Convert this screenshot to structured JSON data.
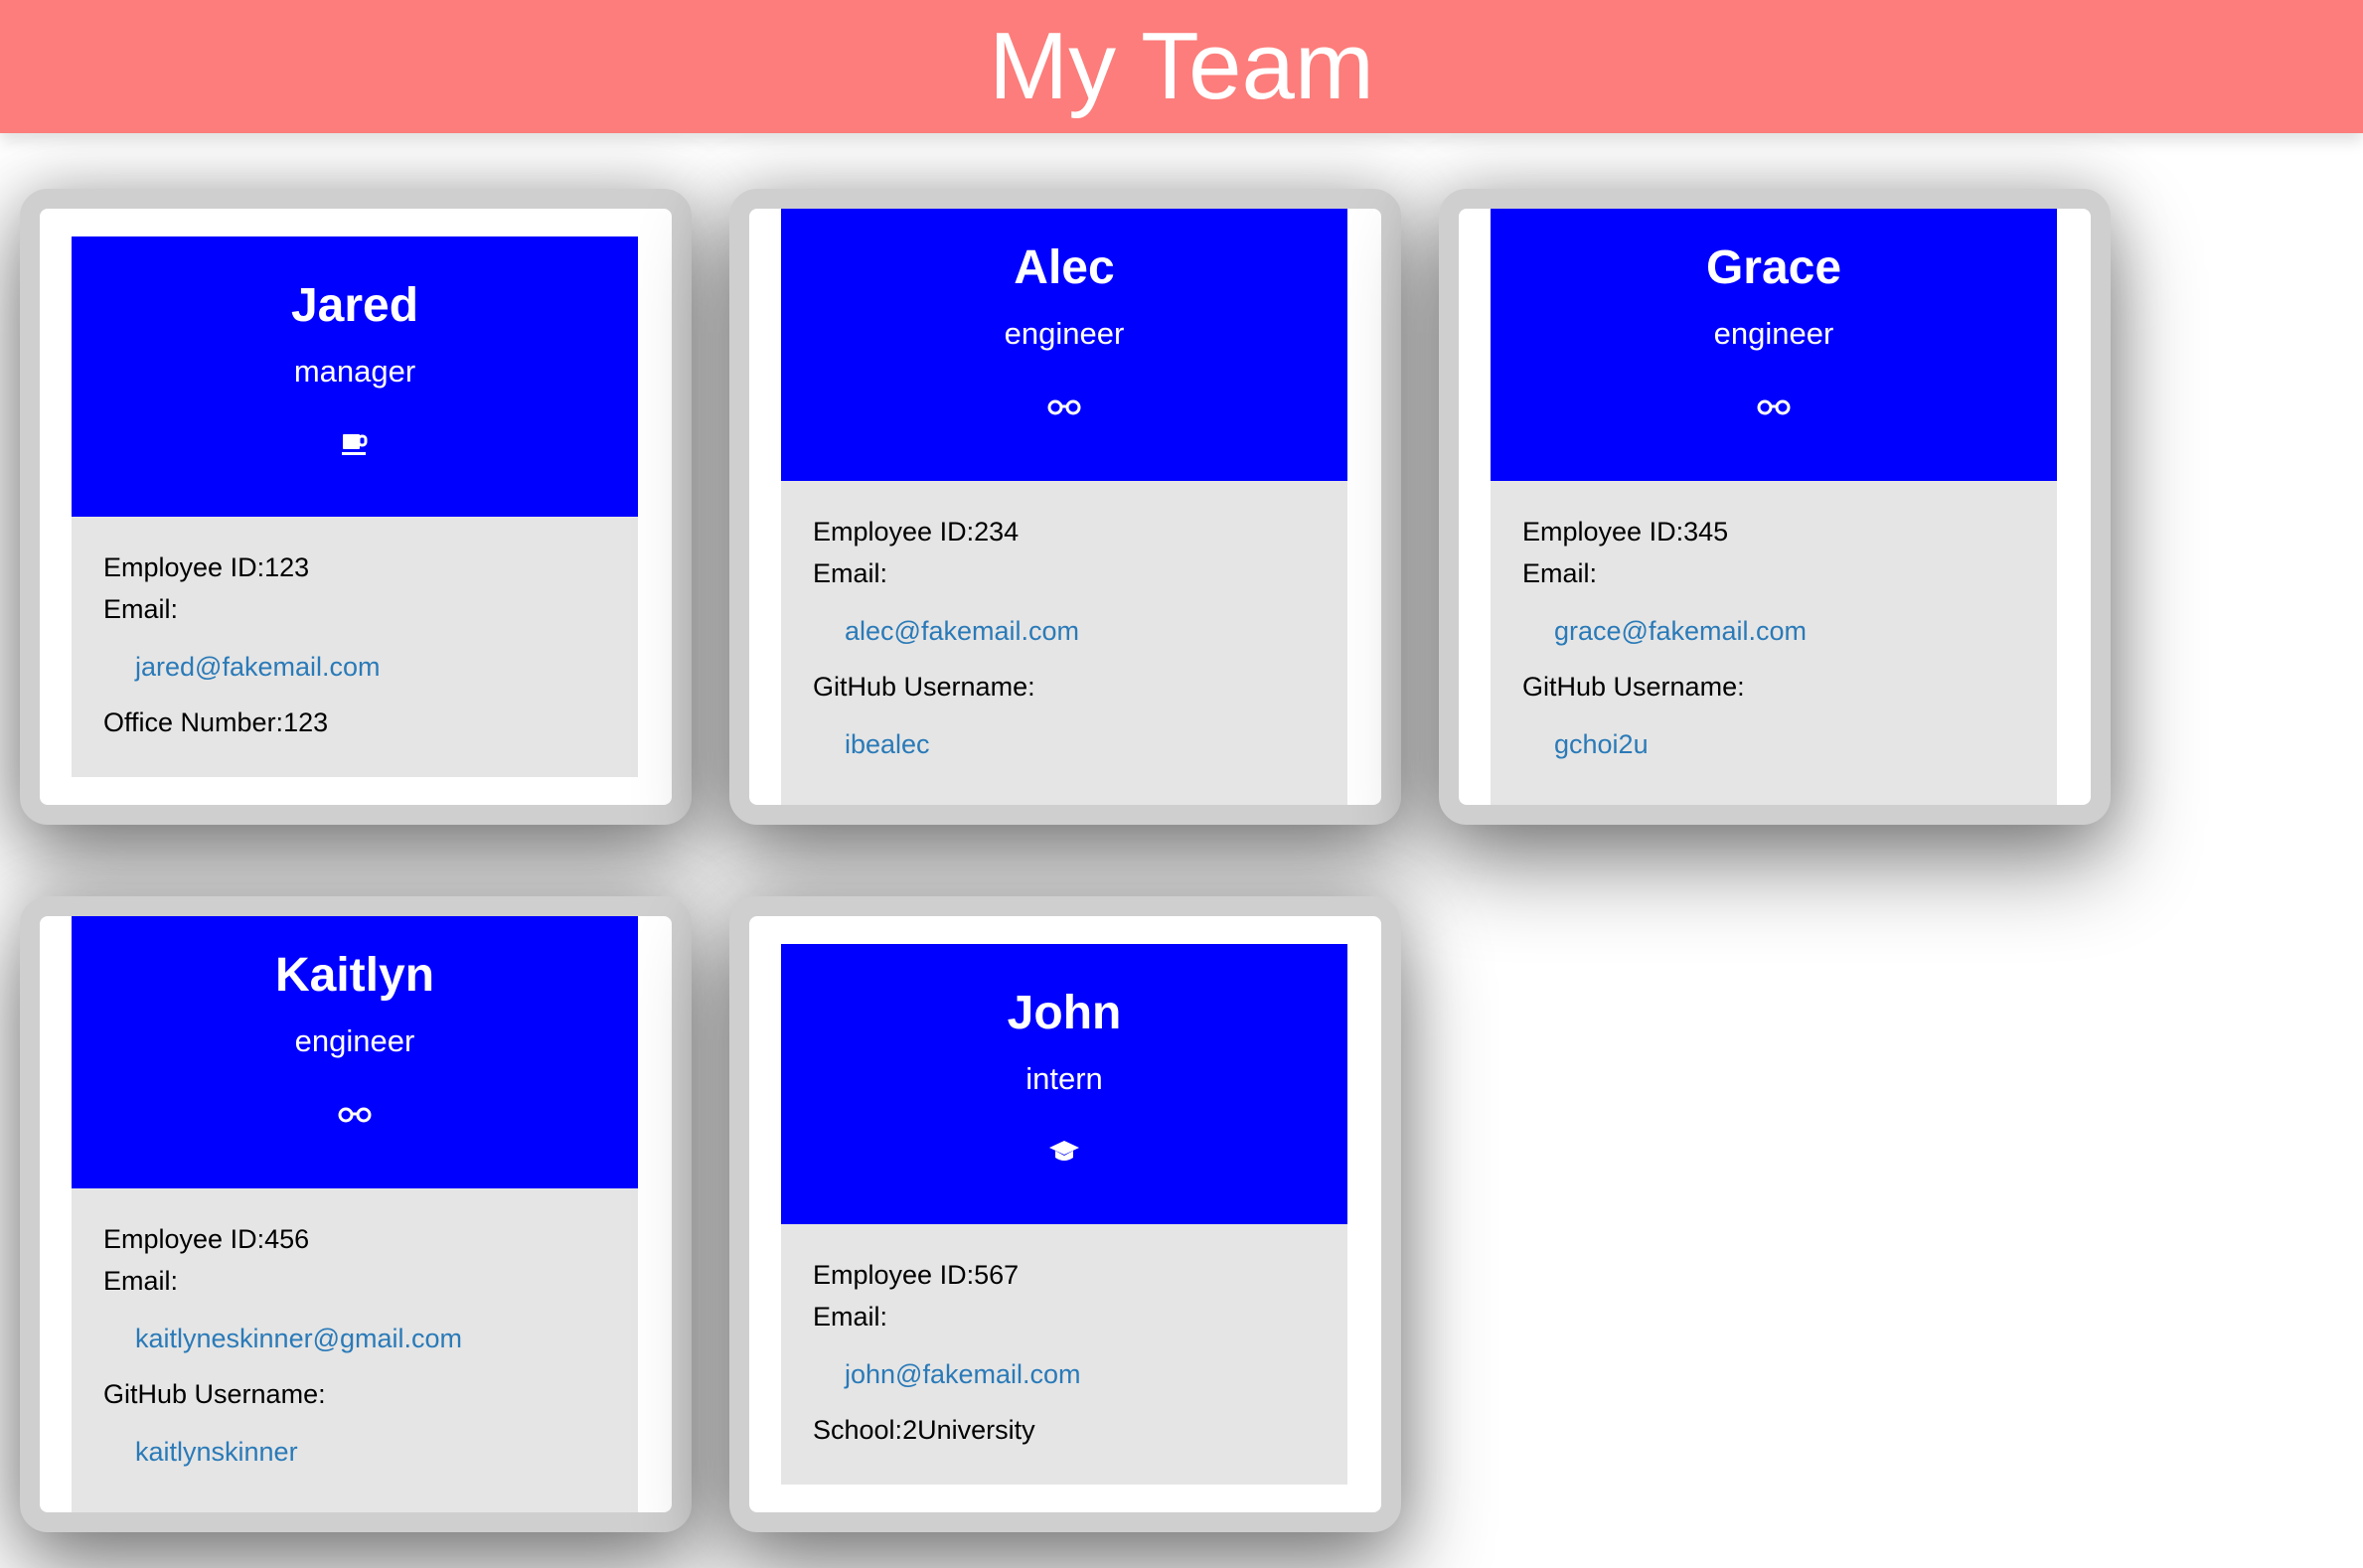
{
  "header": {
    "title": "My Team"
  },
  "labels": {
    "employee_id": "Employee ID:",
    "email": "Email:",
    "office": "Office Number:",
    "github": "GitHub Username:",
    "school": "School:"
  },
  "cards": [
    {
      "name": "Jared",
      "role": "manager",
      "icon": "coffee-icon",
      "id": "123",
      "email": "jared@fakemail.com",
      "office": "123"
    },
    {
      "name": "Alec",
      "role": "engineer",
      "icon": "glasses-icon",
      "id": "234",
      "email": "alec@fakemail.com",
      "github": "ibealec"
    },
    {
      "name": "Grace",
      "role": "engineer",
      "icon": "glasses-icon",
      "id": "345",
      "email": "grace@fakemail.com",
      "github": "gchoi2u"
    },
    {
      "name": "Kaitlyn",
      "role": "engineer",
      "icon": "glasses-icon",
      "id": "456",
      "email": "kaitlyneskinner@gmail.com",
      "github": "kaitlynskinner"
    },
    {
      "name": "John",
      "role": "intern",
      "icon": "graduation-cap-icon",
      "id": "567",
      "email": "john@fakemail.com",
      "school": "2University"
    }
  ],
  "colors": {
    "header_bg": "#fc7d7b",
    "card_head_bg": "#0000ff",
    "card_body_bg": "#e5e5e5",
    "link": "#2a7ab8"
  }
}
